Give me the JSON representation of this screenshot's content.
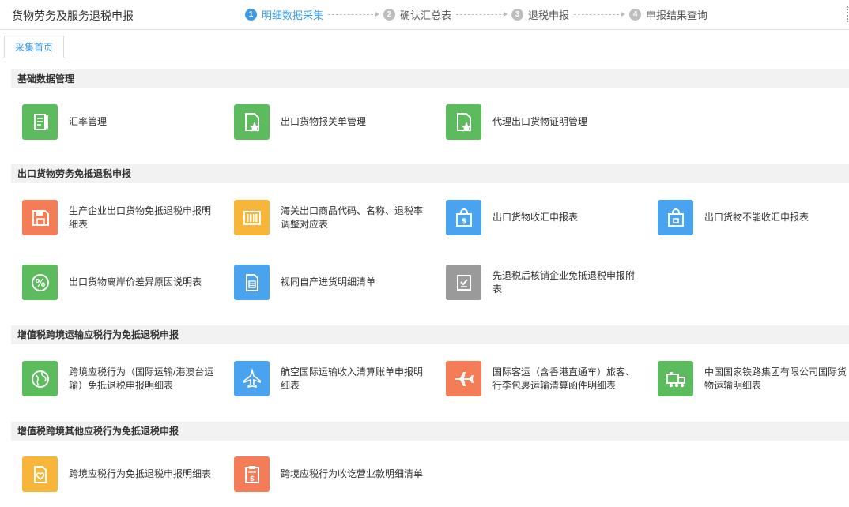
{
  "app": {
    "title": "货物劳务及服务退税申报"
  },
  "steps": [
    {
      "num": "1",
      "label": "明细数据采集"
    },
    {
      "num": "2",
      "label": "确认汇总表"
    },
    {
      "num": "3",
      "label": "退税申报"
    },
    {
      "num": "4",
      "label": "申报结果查询"
    }
  ],
  "tabs": [
    {
      "label": "采集首页"
    }
  ],
  "sections": [
    {
      "title": "基础数据管理",
      "items": [
        {
          "label": "汇率管理",
          "icon": "notebook-pen-icon",
          "color": "#5cbb5c"
        },
        {
          "label": "出口货物报关单管理",
          "icon": "document-star-icon",
          "color": "#5cbb5c"
        },
        {
          "label": "代理出口货物证明管理",
          "icon": "document-star-icon",
          "color": "#5cbb5c"
        }
      ]
    },
    {
      "title": "出口货物劳务免抵退税申报",
      "items": [
        {
          "label": "生产企业出口货物免抵退税申报明细表",
          "icon": "floppy-disk-icon",
          "color": "#f47d57"
        },
        {
          "label": "海关出口商品代码、名称、退税率调整对应表",
          "icon": "barcode-icon",
          "color": "#f7b539"
        },
        {
          "label": "出口货物收汇申报表",
          "icon": "shopping-bag-dollar-icon",
          "color": "#4aa3ee"
        },
        {
          "label": "出口货物不能收汇申报表",
          "icon": "shopping-bag-lock-icon",
          "color": "#4aa3ee"
        },
        {
          "label": "出口货物离岸价差异原因说明表",
          "icon": "percent-icon",
          "color": "#5cbb5c"
        },
        {
          "label": "视同自产进货明细清单",
          "icon": "document-list-icon",
          "color": "#4aa3ee"
        },
        {
          "label": "先退税后核销企业免抵退税申报附表",
          "icon": "checkbox-icon",
          "color": "#9a9a9a"
        }
      ]
    },
    {
      "title": "增值税跨境运输应税行为免抵退税申报",
      "items": [
        {
          "label": "跨境应税行为（国际运输/港澳台运输）免抵退税申报明细表",
          "icon": "globe-icon",
          "color": "#5cbb5c"
        },
        {
          "label": "航空国际运输收入清算账单申报明细表",
          "icon": "airplane-up-icon",
          "color": "#4aa3ee"
        },
        {
          "label": "国际客运（含香港直通车）旅客、行李包裹运输清算函件明细表",
          "icon": "airplane-icon",
          "color": "#f47d57"
        },
        {
          "label": "中国国家铁路集团有限公司国际货物运输明细表",
          "icon": "train-icon",
          "color": "#5cbb5c"
        }
      ]
    },
    {
      "title": "增值税跨境其他应税行为免抵退税申报",
      "items": [
        {
          "label": "跨境应税行为免抵退税申报明细表",
          "icon": "heart-document-icon",
          "color": "#f7b539"
        },
        {
          "label": "跨境应税行为收讫营业款明细清单",
          "icon": "clipboard-dollar-icon",
          "color": "#f47d57"
        }
      ]
    }
  ]
}
